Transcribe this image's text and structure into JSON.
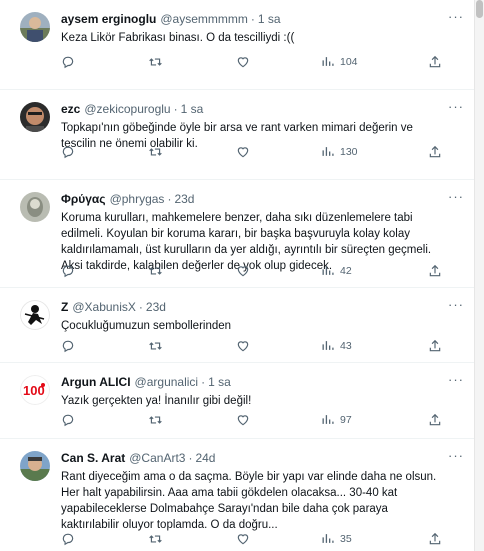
{
  "colors": {
    "text": "#0f1419",
    "muted": "#536471",
    "divider": "#eff3f4"
  },
  "icons": {
    "reply": "speech-bubble-icon",
    "retweet": "retweet-arrows-icon",
    "like": "heart-icon",
    "views": "bar-chart-icon",
    "share": "share-upload-icon",
    "more": "more-dots-icon"
  },
  "more_label": "···",
  "tweets": [
    {
      "name": "aysem erginoglu",
      "handle": "@aysemmmmm",
      "sep": "·",
      "time": "1 sa",
      "text": "Keza Likör Fabrikası binası. O da tescilliydi :((",
      "views": "104"
    },
    {
      "name": "ezc",
      "handle": "@zekicopuroglu",
      "sep": "·",
      "time": "1 sa",
      "text": "Topkapı'nın göbeğinde öyle bir arsa ve rant varken mimari değerin ve\ntescilin ne önemi olabilir ki.",
      "views": "130"
    },
    {
      "name": "Φρύγας",
      "handle": "@phrygas",
      "sep": "·",
      "time": "23d",
      "text": "Koruma kurulları, mahkemelere benzer, daha sıkı düzenlemelere tabi\nedilmeli. Koyulan bir koruma kararı, bir başka başvuruyla kolay kolay\nkaldırılamamalı, üst kurulların da yer aldığı, ayrıntılı bir süreçten geçmeli.\nAksi takdirde, kalabilen değerler de yok olup gidecek.",
      "views": "42"
    },
    {
      "name": "Z",
      "handle": "@XabunisX",
      "sep": "·",
      "time": "23d",
      "text": "Çocukluğumuzun sembollerinden",
      "views": "43"
    },
    {
      "name": "Argun ALICI",
      "handle": "@argunalici",
      "sep": "·",
      "time": "1 sa",
      "text": "Yazık gerçekten ya! İnanılır gibi değil!",
      "views": "97"
    },
    {
      "name": "Can S. Arat",
      "handle": "@CanArt3",
      "sep": "·",
      "time": "24d",
      "text": "Rant diyeceğim ama o da saçma. Böyle bir yapı var elinde daha ne olsun.\nHer halt yapabilirsin. Aaa ama tabii gökdelen olacaksa... 30-40 kat\nyapabileceklerse Dolmabahçe Sarayı'ndan bile daha çok paraya\nkaktırılabilir oluyor toplamda. O da doğru...",
      "views": "35"
    }
  ]
}
